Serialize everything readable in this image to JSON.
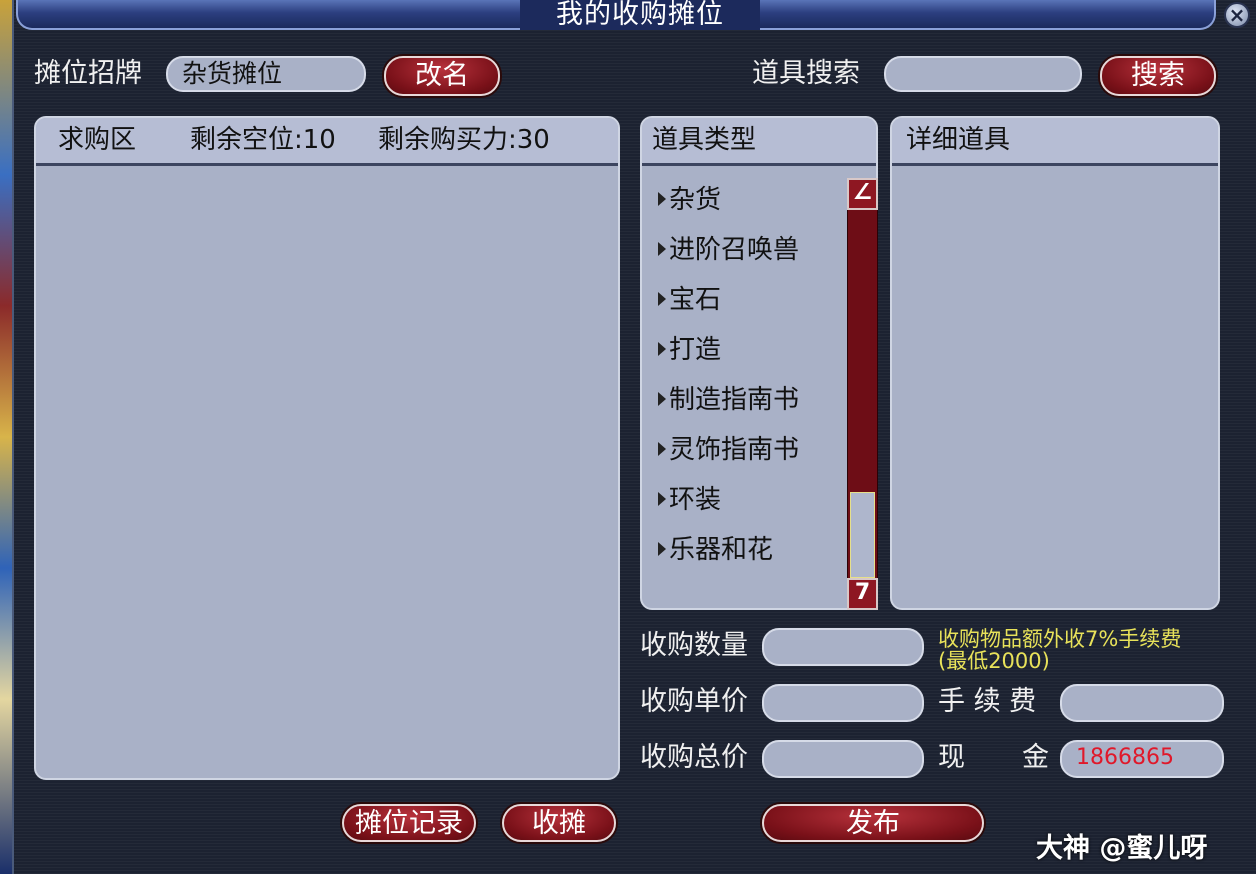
{
  "window": {
    "title": "我的收购摊位",
    "close_symbol": "×"
  },
  "stall": {
    "sign_label": "摊位招牌",
    "sign_value": "杂货摊位",
    "rename_button": "改名"
  },
  "search": {
    "label": "道具搜索",
    "value": "",
    "button": "搜索"
  },
  "buy_area": {
    "title": "求购区",
    "slots_label": "剩余空位:10",
    "power_label": "剩余购买力:30"
  },
  "categories": {
    "title": "道具类型",
    "items": [
      "杂货",
      "进阶召唤兽",
      "宝石",
      "打造",
      "制造指南书",
      "灵饰指南书",
      "环装",
      "乐器和花"
    ],
    "scroll_up_icon": "scroll-up-icon",
    "scroll_down_icon": "scroll-down-icon"
  },
  "details": {
    "title": "详细道具"
  },
  "form": {
    "quantity_label": "收购数量",
    "unit_price_label": "收购单价",
    "total_price_label": "收购总价",
    "fee_label": "手 续 费",
    "cash_label_1": "现",
    "cash_label_2": "金",
    "cash_value": "1866865",
    "notice_line1": "收购物品额外收7%手续费",
    "notice_line2": "(最低2000)"
  },
  "bottom_buttons": {
    "record": "摊位记录",
    "close_stall": "收摊",
    "publish": "发布"
  },
  "watermark": {
    "text": "大神 @蜜儿呀"
  },
  "colors": {
    "button_red": "#7a1119",
    "field_gray": "#a9b1c7",
    "notice_yellow": "#e8e25a",
    "cash_red": "#e0182a"
  }
}
